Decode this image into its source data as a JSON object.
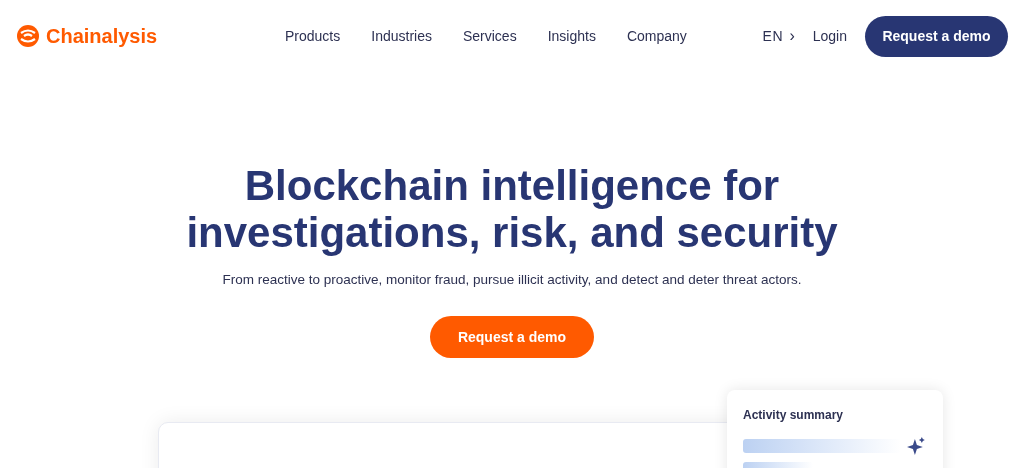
{
  "header": {
    "logo": "Chainalysis",
    "nav": [
      {
        "label": "Products"
      },
      {
        "label": "Industries"
      },
      {
        "label": "Services"
      },
      {
        "label": "Insights"
      },
      {
        "label": "Company"
      }
    ],
    "language": "EN",
    "language_arrow": "›",
    "login": "Login",
    "demo_button": "Request a demo"
  },
  "hero": {
    "title_lines": [
      "Blockchain intelligence for",
      "investigations, risk, and security"
    ],
    "subtitle": "From reactive to proactive, monitor fraud, pursue illicit activity, and detect and deter threat actors.",
    "cta": "Request a demo"
  },
  "activity_card": {
    "title": "Activity summary"
  }
}
